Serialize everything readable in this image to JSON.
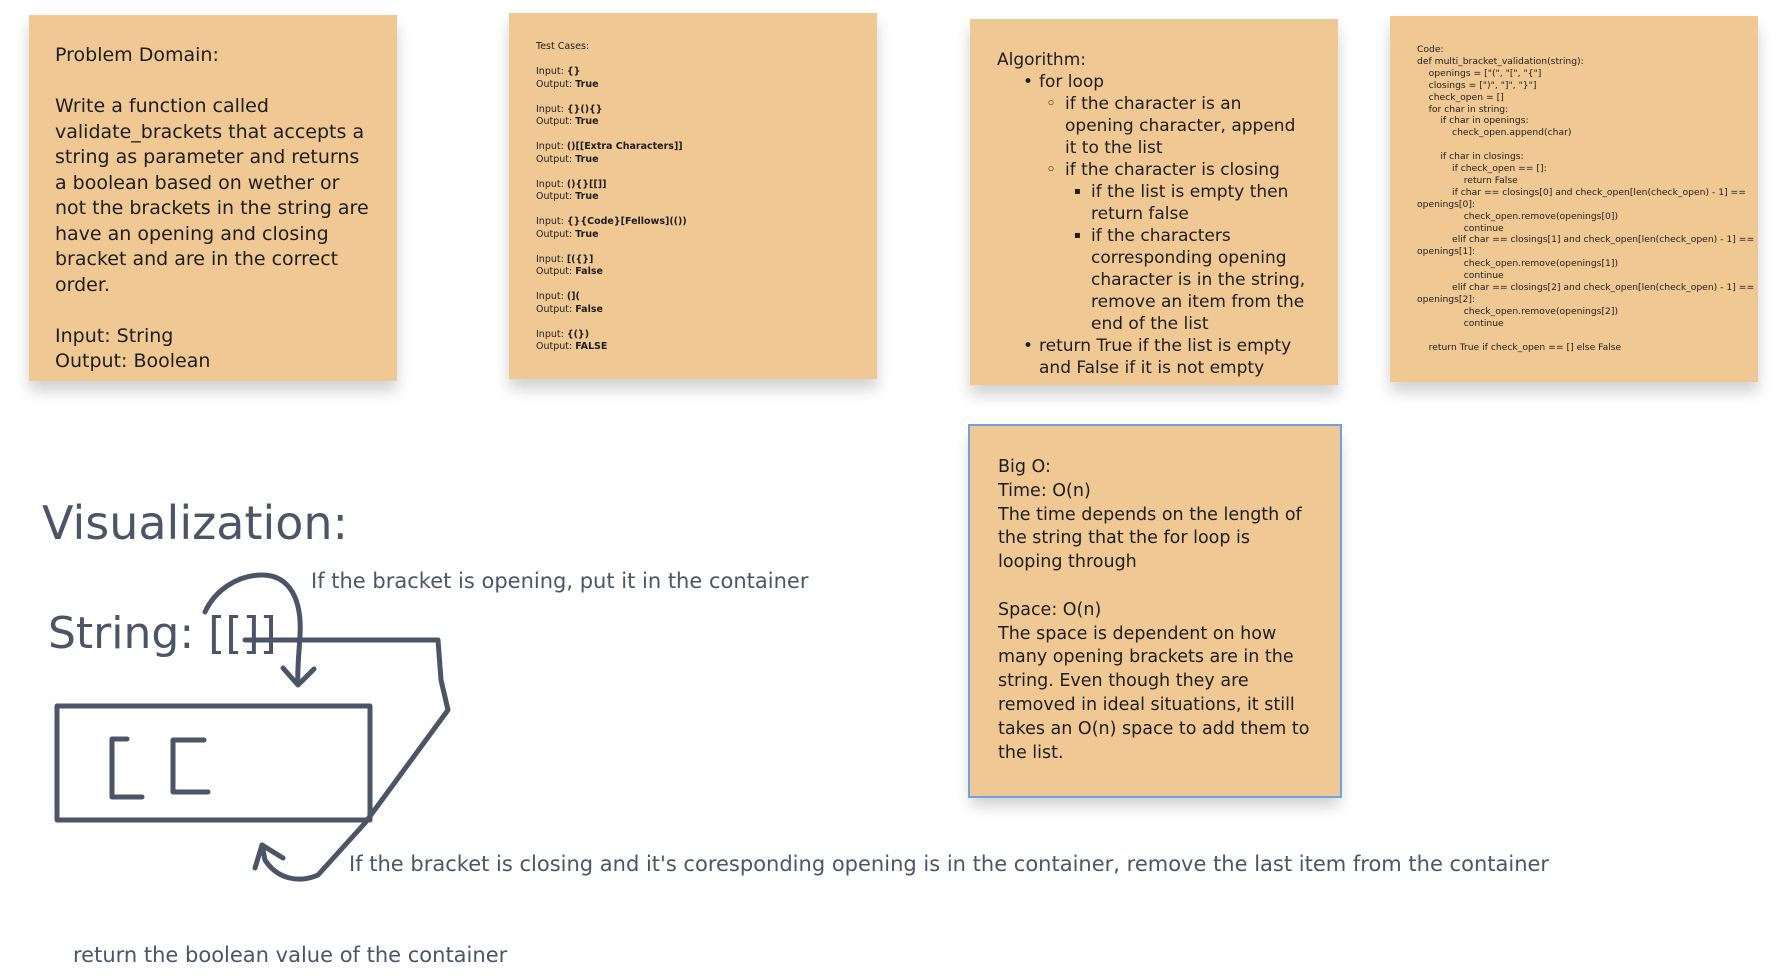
{
  "notes": {
    "problem_domain": {
      "paragraphs": [
        "Problem Domain:",
        "Write a function called validate_brackets that accepts a string as parameter and returns a boolean based on wether or not the brackets in the string are have an opening and closing bracket and are in the correct order.",
        "Input: String\nOutput: Boolean"
      ]
    },
    "test_cases": {
      "title": "Test Cases:",
      "input_prefix": "Input: ",
      "output_prefix": "Output: ",
      "cases": [
        {
          "input": "{}",
          "output": "True"
        },
        {
          "input": "{}(){}",
          "output": "True"
        },
        {
          "input": "()[[Extra Characters]]",
          "output": "True"
        },
        {
          "input": "(){}[[]]",
          "output": "True"
        },
        {
          "input": "{}{Code}[Fellows](())",
          "output": "True"
        },
        {
          "input": "[({}]",
          "output": "False"
        },
        {
          "input": "(](",
          "output": "False"
        },
        {
          "input": "{(})",
          "output": "FALSE"
        }
      ]
    },
    "algorithm": {
      "title": "Algorithm:",
      "loop": "for loop",
      "if_opening": "if the character is an opening character, append it to the list",
      "if_closing": "if the character is closing",
      "if_empty": "if the list is empty then return false",
      "if_corresponding": "if the characters corresponding opening character is in the string, remove an item from the end of the list",
      "return": "return True if the list is empty and False if it is not empty"
    },
    "code": {
      "lines": [
        "Code:",
        "def multi_bracket_validation(string):",
        "    openings = [\"(\", \"[\", \"{\"]",
        "    closings = [\")\", \"]\", \"}\"]",
        "    check_open = []",
        "    for char in string:",
        "        if char in openings:",
        "            check_open.append(char)",
        "",
        "        if char in closings:",
        "            if check_open == []:",
        "                return False",
        "            if char == closings[0] and check_open[len(check_open) - 1] ==",
        "openings[0]:",
        "                check_open.remove(openings[0])",
        "                continue",
        "            elif char == closings[1] and check_open[len(check_open) - 1] ==",
        "openings[1]:",
        "                check_open.remove(openings[1])",
        "                continue",
        "            elif char == closings[2] and check_open[len(check_open) - 1] ==",
        "openings[2]:",
        "                check_open.remove(openings[2])",
        "                continue",
        "",
        "    return True if check_open == [] else False"
      ]
    },
    "big_o": {
      "paragraphs": [
        "Big O:\nTime: O(n)\nThe time depends on the length of the string that the for loop is looping through",
        "Space: O(n)\nThe space is dependent on how many opening brackets are in the string. Even though they are removed in ideal situations, it still takes an O(n) space to add them to the list."
      ]
    }
  },
  "visualization": {
    "title": "Visualization:",
    "string_label": "String: [[]]",
    "container_content": "[[",
    "annotation_opening": "If the bracket is opening, put it in the container",
    "annotation_closing": "If the bracket is closing and it's coresponding opening is in the container, remove the last item from the container",
    "annotation_return": "return the boolean value of the container"
  },
  "colors": {
    "sticky_note": "#f0c893",
    "ink": "#4b5565",
    "selection": "#6fa3e0"
  }
}
